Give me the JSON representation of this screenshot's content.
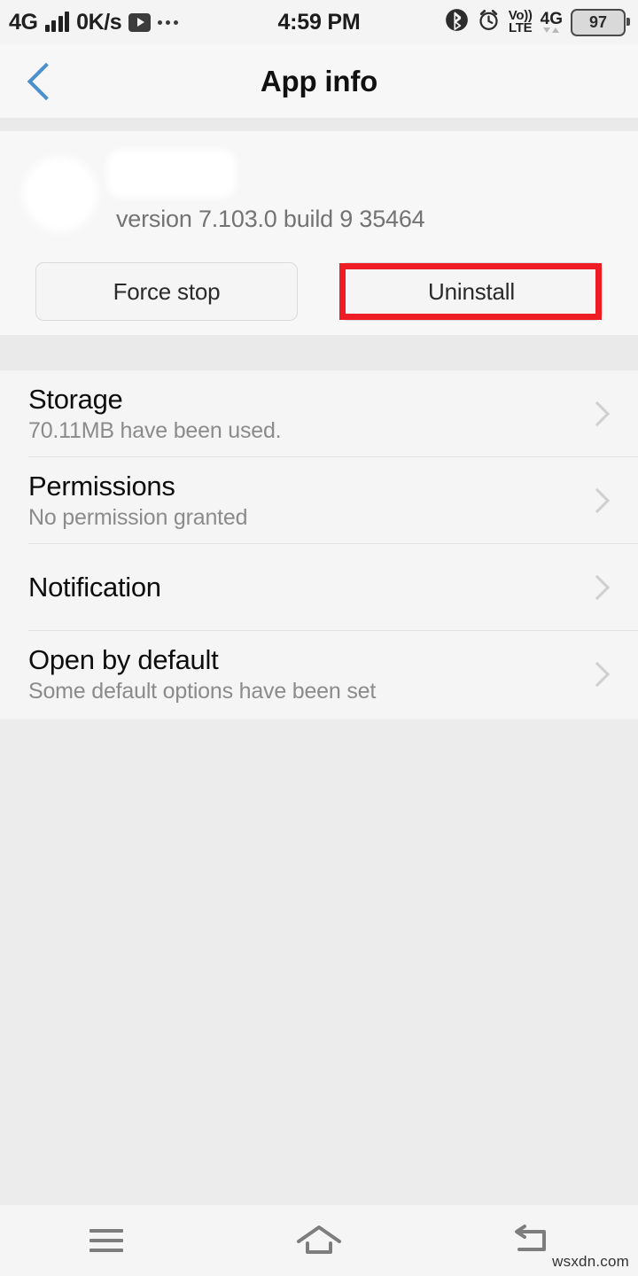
{
  "status_bar": {
    "network_type": "4G",
    "data_speed": "0K/s",
    "media_icon": "play-icon",
    "overflow_icon": "more-dots-icon",
    "clock": "4:59 PM",
    "bluetooth_icon": "bluetooth-icon",
    "alarm_icon": "alarm-clock-icon",
    "volte_top": "Vo))",
    "volte_bottom": "LTE",
    "mobile_network": "4G",
    "battery_level": "97"
  },
  "header": {
    "back_icon": "chevron-left-icon",
    "title": "App info"
  },
  "app": {
    "icon": "app-icon-redacted",
    "name": "",
    "version": "version 7.103.0 build 9 35464",
    "buttons": {
      "force_stop": "Force stop",
      "uninstall": "Uninstall"
    },
    "annotation_color": "#ee1c24"
  },
  "list": {
    "rows": [
      {
        "title": "Storage",
        "subtitle": "70.11MB have been used.",
        "chevron": "chevron-right-icon"
      },
      {
        "title": "Permissions",
        "subtitle": "No permission granted",
        "chevron": "chevron-right-icon"
      },
      {
        "title": "Notification",
        "subtitle": "",
        "chevron": "chevron-right-icon"
      },
      {
        "title": "Open by default",
        "subtitle": "Some default options have been set",
        "chevron": "chevron-right-icon"
      }
    ]
  },
  "nav_bar": {
    "menu_icon": "menu-icon",
    "home_icon": "home-icon",
    "back_icon": "back-arrow-icon"
  },
  "watermark": "wsxdn.com",
  "colors": {
    "accent_blue": "#4a90d0",
    "annotation_red": "#ee1c24",
    "page_background": "#ececec",
    "card_background": "#f5f5f5"
  }
}
